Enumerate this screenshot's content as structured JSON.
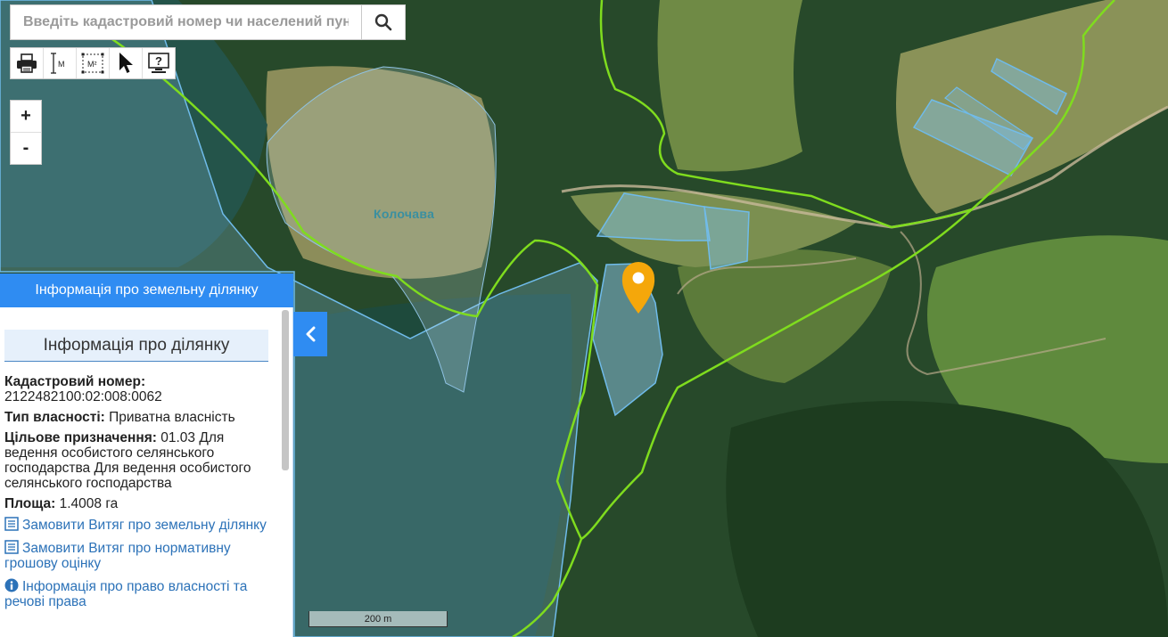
{
  "search": {
    "placeholder": "Введіть кадастровий номер чи населений пункт"
  },
  "toolbar": {
    "items": [
      {
        "icon": "printer-icon"
      },
      {
        "icon": "measure-length-icon",
        "label": "М"
      },
      {
        "icon": "measure-area-icon",
        "label": "М²"
      },
      {
        "icon": "pointer-icon"
      },
      {
        "icon": "help-icon"
      }
    ]
  },
  "zoom": {
    "in": "+",
    "out": "-"
  },
  "map": {
    "place_label": "Колочава",
    "scale_label": "200 m",
    "colors": {
      "boundary": "#7fdc1e",
      "parcel": "#6fbbea",
      "marker": "#f5a70a"
    }
  },
  "panel": {
    "header": "Інформація про земельну ділянку",
    "section_title": "Інформація про ділянку",
    "cadastral_label": "Кадастровий номер:",
    "cadastral_value": "2122482100:02:008:0062",
    "ownership_label": "Тип власності:",
    "ownership_value": "Приватна власність",
    "purpose_label": "Цільове призначення:",
    "purpose_value": "01.03 Для ведення особистого селянського господарства Для ведення особистого селянського господарства",
    "area_label": "Площа:",
    "area_value": "1.4008 га",
    "links": [
      {
        "icon": "document-list-icon",
        "text": "Замовити Витяг про земельну ділянку"
      },
      {
        "icon": "document-list-icon",
        "text": "Замовити Витяг про нормативну грошову оцінку"
      },
      {
        "icon": "info-icon",
        "text": "Інформація про право власності та речові права"
      }
    ]
  }
}
